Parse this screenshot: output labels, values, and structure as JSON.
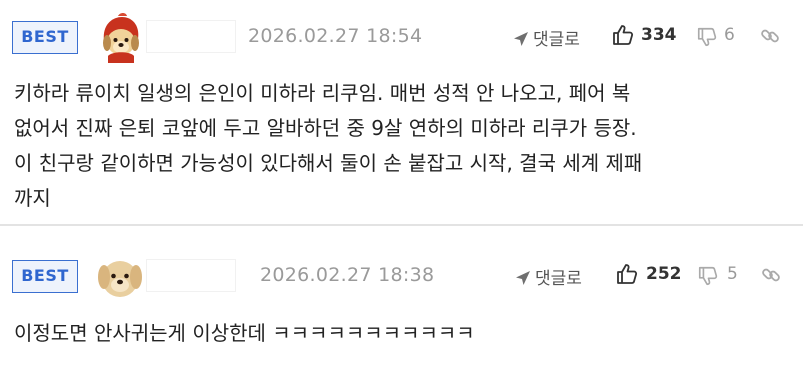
{
  "comments": [
    {
      "badge": "BEST",
      "avatar": "red-hooded-dog-avatar",
      "date": "2026.02.27 18:54",
      "reply_label": "댓글로",
      "likes": "334",
      "dislikes": "6",
      "body": "키하라 류이치 일생의 은인이 미하라 리쿠임. 매번 성적 안 나오고, 페어 복\n없어서 진짜 은퇴 코앞에 두고 알바하던 중 9살 연하의 미하라 리쿠가 등장.\n이 친구랑 같이하면 가능성이 있다해서 둘이 손 붙잡고 시작, 결국 세계 제패\n까지"
    },
    {
      "badge": "BEST",
      "avatar": "puppy-avatar",
      "date": "2026.02.27 18:38",
      "reply_label": "댓글로",
      "likes": "252",
      "dislikes": "5",
      "body": "이정도면 안사귀는게 이상한데 ㅋㅋㅋㅋㅋㅋㅋㅋㅋㅋㅋ"
    }
  ],
  "icons": {
    "reply": "paper-plane-icon",
    "like": "thumbs-up-icon",
    "dislike": "thumbs-down-icon",
    "link": "link-icon"
  },
  "colors": {
    "badge_border": "#3a6fd0",
    "badge_text": "#2f66cf",
    "badge_bg": "#eef3fc",
    "meta_gray": "#9a9a9a",
    "body_text": "#222222"
  }
}
